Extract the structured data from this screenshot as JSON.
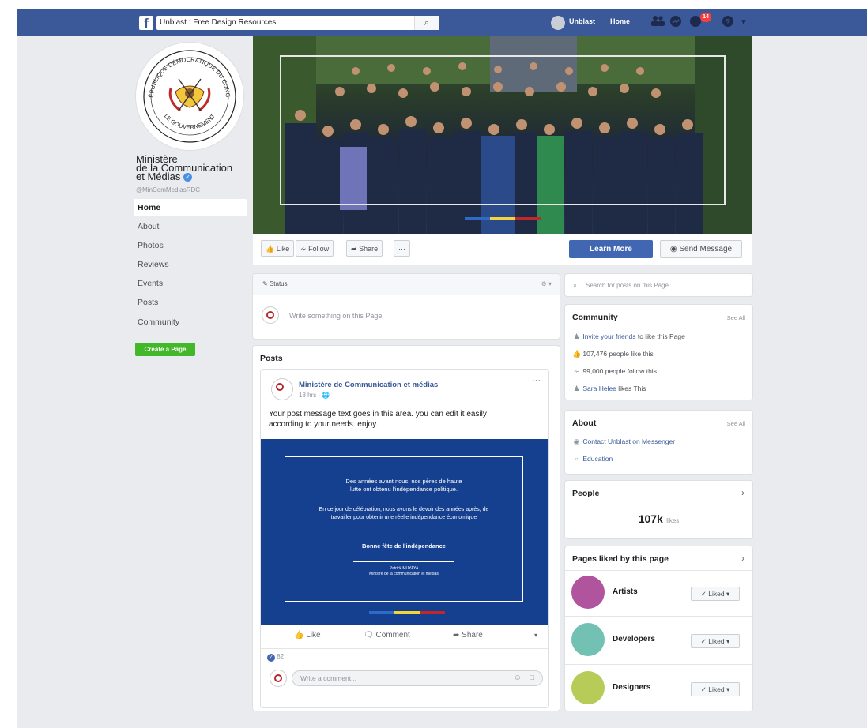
{
  "topbar": {
    "logo": "f",
    "search_value": "Unblast : Free Design Resources",
    "user_name": "Unblast",
    "home": "Home",
    "notifications_count": "14"
  },
  "page": {
    "name_line1": "Ministère",
    "name_line2": "de la Communication",
    "name_line3": "et Médias",
    "handle": "@MinComMediasRDC",
    "logo_arc_top": "RÉPUBLIQUE DÉMOCRATIQUE DU CONGO",
    "logo_arc_bottom": "LE GOUVERNEMENT"
  },
  "nav": {
    "items": [
      "Home",
      "About",
      "Photos",
      "Reviews",
      "Events",
      "Posts",
      "Community"
    ],
    "create_page": "Create a Page"
  },
  "actions": {
    "like": "Like",
    "follow": "Follow",
    "share": "Share",
    "more": "···",
    "learn_more": "Learn More",
    "send_message": "Send Message"
  },
  "composer": {
    "tab": "Status",
    "placeholder": "Write something on this Page"
  },
  "posts": {
    "heading": "Posts",
    "author": "Ministère de Communication et médias",
    "time": "18 hrs",
    "text_line1": "Your post message text goes in this area. you can edit it easily",
    "text_line2": "according to your needs. enjoy.",
    "image_line1": "Des années avant nous, nos pères de haute",
    "image_line2": "lutte ont obtenu l'indépendance politique.",
    "image_line3": "En ce jour de célébration, nous avons le devoir des années après, de",
    "image_line4": "travailler pour obtenir une réelle indépendance économique",
    "image_line5": "Bonne fête de l'indépendance",
    "image_sig1": "Patrick MUYAYA",
    "image_sig2": "Ministre de la communication et médias",
    "like": "Like",
    "comment": "Comment",
    "share": "Share",
    "reactions": "82",
    "comment_placeholder": "Write a comment..."
  },
  "right": {
    "search_placeholder": "Search for posts on this Page",
    "community_title": "Community",
    "see_all": "See All",
    "invite_link": "Invite your friends",
    "invite_rest": " to like this Page",
    "likes_count": "107,476 people like this",
    "follow_count": "99,000 people follow this",
    "friend_link": "Sara Helee",
    "friend_rest": " likes This",
    "about_title": "About",
    "contact": "Contact Unblast on Messenger",
    "education": "Education",
    "people_title": "People",
    "people_count": "107k",
    "people_unit": "likes",
    "pages_liked_title": "Pages liked by this page",
    "pages": [
      {
        "name": "Artists",
        "color": "#b0549e",
        "btn": "Liked"
      },
      {
        "name": "Developers",
        "color": "#72c1b2",
        "btn": "Liked"
      },
      {
        "name": "Designers",
        "color": "#b6cb58",
        "btn": "Liked"
      }
    ]
  },
  "colors": {
    "fb_blue": "#3b5998",
    "button_blue": "#4267b2",
    "post_blue": "#153f8f",
    "flag_blue": "#2e6bc9",
    "flag_yellow": "#f4d43a",
    "flag_red": "#c0282c",
    "green": "#42b72a"
  }
}
